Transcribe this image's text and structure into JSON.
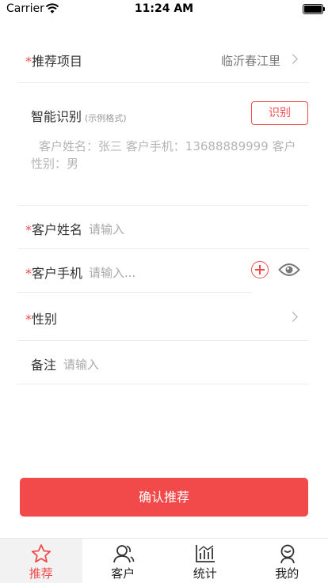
{
  "status_bar": {
    "carrier": "Carrier",
    "time": "11:24 AM"
  },
  "form": {
    "required_mark": "*",
    "project": {
      "label": "推荐项目",
      "value": "临沂春江里"
    },
    "smart_recognition": {
      "title": "智能识别",
      "subtitle": "(示例格式)",
      "button": "识别",
      "sample": "客户姓名：张三  客户手机：13688889999  客户性别：男"
    },
    "customer_name": {
      "label": "客户姓名",
      "placeholder": "请输入"
    },
    "customer_phone": {
      "label": "客户手机",
      "placeholder": "请输入..."
    },
    "gender": {
      "label": "性别"
    },
    "remark": {
      "label": "备注",
      "placeholder": "请输入"
    }
  },
  "confirm_button": "确认推荐",
  "tabbar": {
    "items": [
      {
        "label": "推荐",
        "icon": "star-icon",
        "active": true
      },
      {
        "label": "客户",
        "icon": "customers-icon",
        "active": false
      },
      {
        "label": "统计",
        "icon": "stats-icon",
        "active": false
      },
      {
        "label": "我的",
        "icon": "profile-icon",
        "active": false
      }
    ]
  },
  "colors": {
    "accent": "#f24a4a",
    "placeholder": "#a8a8a8",
    "divider": "#ececec"
  }
}
